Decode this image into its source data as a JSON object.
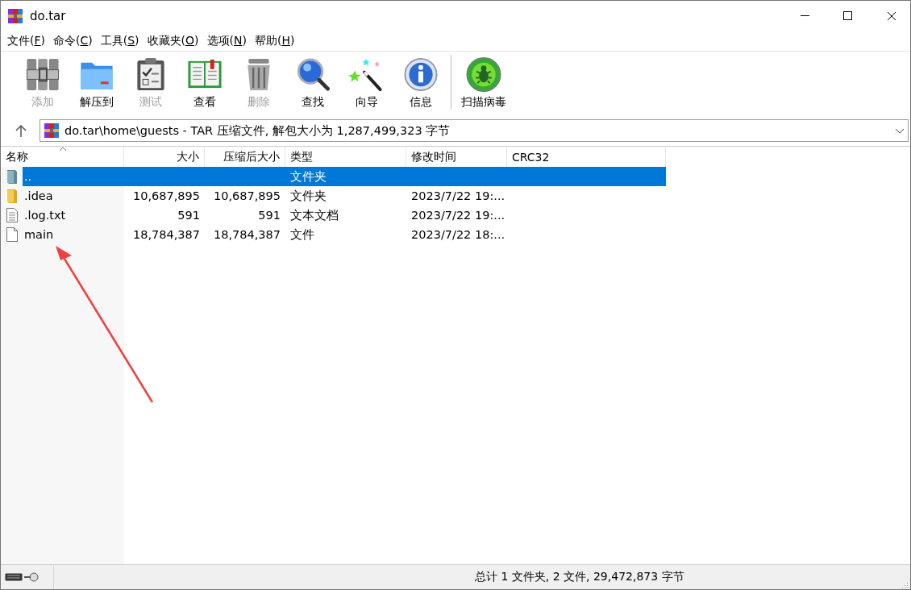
{
  "window": {
    "title": "do.tar"
  },
  "menu": [
    {
      "text": "文件(",
      "access_key": "F",
      "after": ")"
    },
    {
      "text": "命令(",
      "access_key": "C",
      "after": ")"
    },
    {
      "text": "工具(",
      "access_key": "S",
      "after": ")"
    },
    {
      "text": "收藏夹(",
      "access_key": "O",
      "after": ")"
    },
    {
      "text": "选项(",
      "access_key": "N",
      "after": ")"
    },
    {
      "text": "帮助(",
      "access_key": "H",
      "after": ")"
    }
  ],
  "toolbar": [
    [
      {
        "kind": "add",
        "label": "添加",
        "disabled": true
      },
      {
        "kind": "extract",
        "label": "解压到",
        "disabled": false
      },
      {
        "kind": "test",
        "label": "测试",
        "disabled": true
      },
      {
        "kind": "view",
        "label": "查看",
        "disabled": false
      },
      {
        "kind": "delete",
        "label": "删除",
        "disabled": true
      },
      {
        "kind": "find",
        "label": "查找",
        "disabled": false
      },
      {
        "kind": "wizard",
        "label": "向导",
        "disabled": false
      },
      {
        "kind": "info",
        "label": "信息",
        "disabled": false
      }
    ],
    [
      {
        "kind": "virus",
        "label": "扫描病毒",
        "disabled": false
      }
    ]
  ],
  "address": {
    "path": "do.tar\\home\\guests - TAR 压缩文件, 解包大小为 1,287,499,323 字节"
  },
  "table": {
    "columns": [
      "名称",
      "大小",
      "压缩后大小",
      "类型",
      "修改时间",
      "CRC32"
    ],
    "rows": [
      {
        "kind": "parent",
        "selected": true,
        "cells": [
          "..",
          "",
          "",
          "文件夹",
          "",
          ""
        ]
      },
      {
        "kind": "folder",
        "selected": false,
        "cells": [
          ".idea",
          "10,687,895",
          "10,687,895",
          "文件夹",
          "2023/7/22 19:...",
          ""
        ]
      },
      {
        "kind": "text",
        "selected": false,
        "cells": [
          ".log.txt",
          "591",
          "591",
          "文本文档",
          "2023/7/22 19:...",
          ""
        ]
      },
      {
        "kind": "file",
        "selected": false,
        "cells": [
          "main",
          "18,784,387",
          "18,784,387",
          "文件",
          "2023/7/22 18:...",
          ""
        ]
      }
    ]
  },
  "status_bar": {
    "text": "总计 1 文件夹, 2 文件, 29,472,873 字节"
  }
}
